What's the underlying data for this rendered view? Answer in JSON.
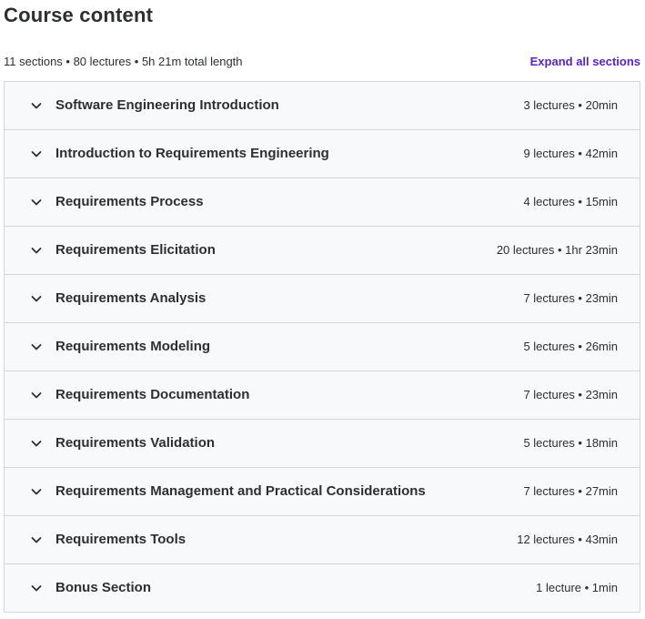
{
  "header": {
    "title": "Course content",
    "summary": "11 sections • 80 lectures • 5h 21m total length",
    "expand_all_label": "Expand all sections",
    "accent_color": "#5624d0"
  },
  "sections": [
    {
      "title": "Software Engineering Introduction",
      "meta": "3 lectures • 20min"
    },
    {
      "title": "Introduction to Requirements Engineering",
      "meta": "9 lectures • 42min"
    },
    {
      "title": "Requirements Process",
      "meta": "4 lectures • 15min"
    },
    {
      "title": "Requirements Elicitation",
      "meta": "20 lectures • 1hr 23min"
    },
    {
      "title": "Requirements Analysis",
      "meta": "7 lectures • 23min"
    },
    {
      "title": "Requirements Modeling",
      "meta": "5 lectures • 26min"
    },
    {
      "title": "Requirements Documentation",
      "meta": "7 lectures • 23min"
    },
    {
      "title": "Requirements Validation",
      "meta": "5 lectures • 18min"
    },
    {
      "title": "Requirements Management and Practical Considerations",
      "meta": "7 lectures • 27min"
    },
    {
      "title": "Requirements Tools",
      "meta": "12 lectures • 43min"
    },
    {
      "title": "Bonus Section",
      "meta": "1 lecture • 1min"
    }
  ],
  "icons": {
    "section_toggle": "chevron-down-icon"
  }
}
